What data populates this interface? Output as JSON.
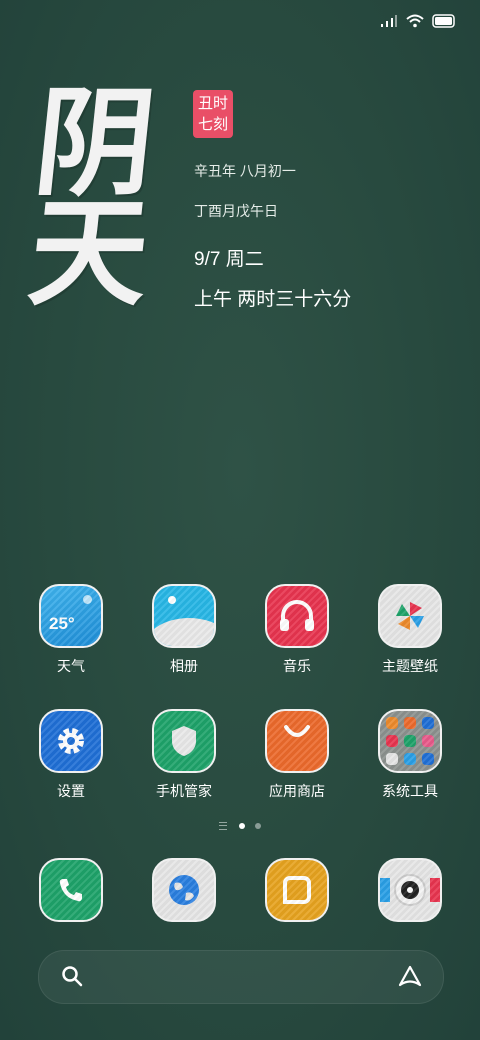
{
  "weather": {
    "char1": "阴",
    "char2": "天"
  },
  "badge": {
    "line1": "丑时",
    "line2": "七刻"
  },
  "lunar_date": "辛丑年 八月初一",
  "ganzhi": "丁酉月戊午日",
  "date": "9/7 周二",
  "time_text": "上午 两时三十六分",
  "apps_row1": [
    {
      "label": "天气",
      "icon": "weather-icon",
      "temp": "25°"
    },
    {
      "label": "相册",
      "icon": "gallery-icon"
    },
    {
      "label": "音乐",
      "icon": "music-icon"
    },
    {
      "label": "主题壁纸",
      "icon": "themes-icon"
    }
  ],
  "apps_row2": [
    {
      "label": "设置",
      "icon": "settings-icon"
    },
    {
      "label": "手机管家",
      "icon": "security-icon"
    },
    {
      "label": "应用商店",
      "icon": "app-store-icon"
    },
    {
      "label": "系统工具",
      "icon": "folder-icon"
    }
  ],
  "dock": [
    {
      "icon": "phone-icon"
    },
    {
      "icon": "browser-icon"
    },
    {
      "icon": "messages-icon"
    },
    {
      "icon": "camera-icon"
    }
  ],
  "page_indicator": {
    "pages": 2,
    "current": 1
  },
  "colors": {
    "background": "#284a3f",
    "badge": "#e94f67",
    "weather": "#2a9fe6",
    "music": "#e8344f",
    "settings": "#1f6fd6",
    "security": "#1ea36a",
    "store": "#ec6a2c",
    "phone": "#1ea36a",
    "messages": "#e7a31f"
  }
}
